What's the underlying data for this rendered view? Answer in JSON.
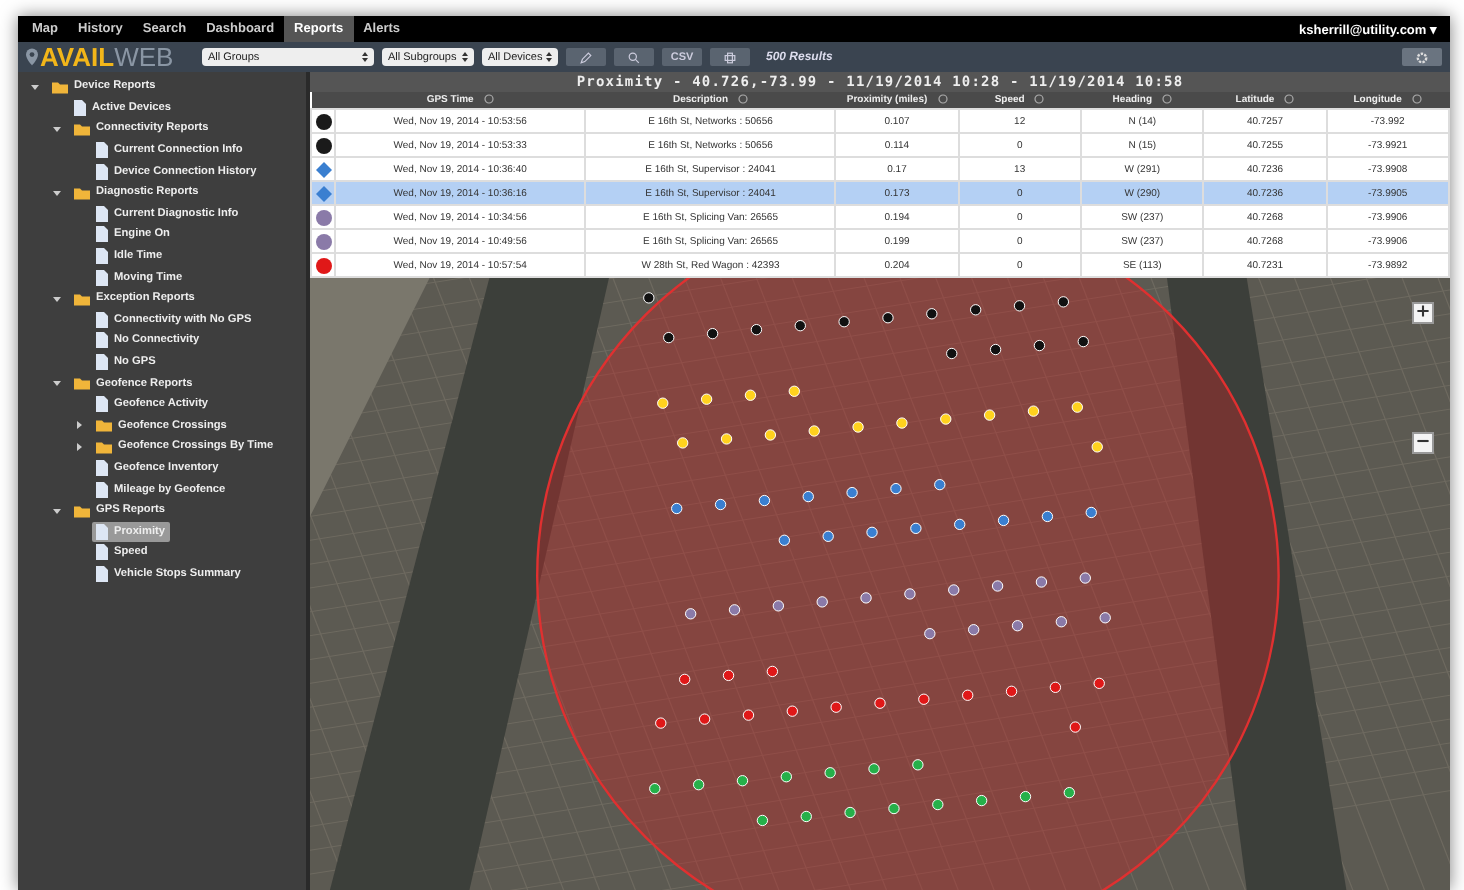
{
  "tabs": [
    {
      "label": "Map",
      "selected": false
    },
    {
      "label": "History",
      "selected": false
    },
    {
      "label": "Search",
      "selected": false
    },
    {
      "label": "Dashboard",
      "selected": false
    },
    {
      "label": "Reports",
      "selected": true
    },
    {
      "label": "Alerts",
      "selected": false
    }
  ],
  "user": "ksherrill@utility.com ▾",
  "logo": {
    "primary": "AVAIL",
    "secondary": "WEB"
  },
  "filters": [
    "All Groups",
    "All Subgroups",
    "All Devices"
  ],
  "csv_button": "CSV",
  "results": "500 Results",
  "sidebar": {
    "items": [
      {
        "label": "Device Reports",
        "kind": "folder",
        "expanded": true,
        "selected": false,
        "children": [
          {
            "label": "Active Devices",
            "kind": "report",
            "selected": false
          },
          {
            "label": "Connectivity Reports",
            "kind": "folder",
            "expanded": true,
            "selected": false,
            "children": [
              {
                "label": "Current Connection Info",
                "kind": "report",
                "selected": false
              },
              {
                "label": "Device Connection History",
                "kind": "report",
                "selected": false
              }
            ]
          },
          {
            "label": "Diagnostic Reports",
            "kind": "folder",
            "expanded": true,
            "selected": false,
            "children": [
              {
                "label": "Current Diagnostic Info",
                "kind": "report",
                "selected": false
              },
              {
                "label": "Engine On",
                "kind": "report",
                "selected": false
              },
              {
                "label": "Idle Time",
                "kind": "report",
                "selected": false
              },
              {
                "label": "Moving Time",
                "kind": "report",
                "selected": false
              }
            ]
          },
          {
            "label": "Exception Reports",
            "kind": "folder",
            "expanded": true,
            "selected": false,
            "children": [
              {
                "label": "Connectivity with No GPS",
                "kind": "report",
                "selected": false
              },
              {
                "label": "No Connectivity",
                "kind": "report",
                "selected": false
              },
              {
                "label": "No GPS",
                "kind": "report",
                "selected": false
              }
            ]
          },
          {
            "label": "Geofence Reports",
            "kind": "folder",
            "expanded": true,
            "selected": false,
            "children": [
              {
                "label": "Geofence Activity",
                "kind": "report",
                "selected": false
              },
              {
                "label": "Geofence Crossings",
                "kind": "folder",
                "expanded": false,
                "selected": false
              },
              {
                "label": "Geofence Crossings By Time",
                "kind": "folder",
                "expanded": false,
                "selected": false
              },
              {
                "label": "Geofence Inventory",
                "kind": "report",
                "selected": false
              },
              {
                "label": "Mileage by Geofence",
                "kind": "report",
                "selected": false
              }
            ]
          },
          {
            "label": "GPS Reports",
            "kind": "folder",
            "expanded": true,
            "selected": false,
            "children": [
              {
                "label": "Proximity",
                "kind": "report",
                "selected": true
              },
              {
                "label": "Speed",
                "kind": "report",
                "selected": false
              },
              {
                "label": "Vehicle Stops Summary",
                "kind": "report",
                "selected": false
              }
            ]
          }
        ]
      }
    ]
  },
  "report_title": "Proximity - 40.726,-73.99 - 11/19/2014 10:28 - 11/19/2014 10:58",
  "table": {
    "columns": [
      "GPS Time",
      "Description",
      "Proximity (miles)",
      "Speed",
      "Heading",
      "Latitude",
      "Longitude"
    ],
    "rows": [
      {
        "kind": "circle",
        "color": "#1a1a1a",
        "selected": false,
        "cells": [
          "Wed, Nov 19, 2014 - 10:53:56",
          "E 16th St, Networks : 50656",
          "0.107",
          "12",
          "N (14)",
          "40.7257",
          "-73.992"
        ]
      },
      {
        "kind": "circle",
        "color": "#1a1a1a",
        "selected": false,
        "cells": [
          "Wed, Nov 19, 2014 - 10:53:33",
          "E 16th St, Networks : 50656",
          "0.114",
          "0",
          "N (15)",
          "40.7255",
          "-73.9921"
        ]
      },
      {
        "kind": "diamond",
        "color": "#3a7fd0",
        "selected": false,
        "cells": [
          "Wed, Nov 19, 2014 - 10:36:40",
          "E 16th St, Supervisor : 24041",
          "0.17",
          "13",
          "W (291)",
          "40.7236",
          "-73.9908"
        ]
      },
      {
        "kind": "diamond",
        "color": "#3a7fd0",
        "selected": true,
        "cells": [
          "Wed, Nov 19, 2014 - 10:36:16",
          "E 16th St, Supervisor : 24041",
          "0.173",
          "0",
          "W (290)",
          "40.7236",
          "-73.9905"
        ]
      },
      {
        "kind": "circle",
        "color": "#8a7aa8",
        "selected": false,
        "cells": [
          "Wed, Nov 19, 2014 - 10:34:56",
          "E 16th St, Splicing Van: 26565",
          "0.194",
          "0",
          "SW (237)",
          "40.7268",
          "-73.9906"
        ]
      },
      {
        "kind": "circle",
        "color": "#8a7aa8",
        "selected": false,
        "cells": [
          "Wed, Nov 19, 2014 - 10:49:56",
          "E 16th St, Splicing Van: 26565",
          "0.199",
          "0",
          "SW (237)",
          "40.7268",
          "-73.9906"
        ]
      },
      {
        "kind": "circle",
        "color": "#e01818",
        "selected": false,
        "cells": [
          "Wed, Nov 19, 2014 - 10:57:54",
          "W 28th St, Red Wagon : 42393",
          "0.204",
          "0",
          "SE (113)",
          "40.7231",
          "-73.9892"
        ]
      }
    ]
  }
}
